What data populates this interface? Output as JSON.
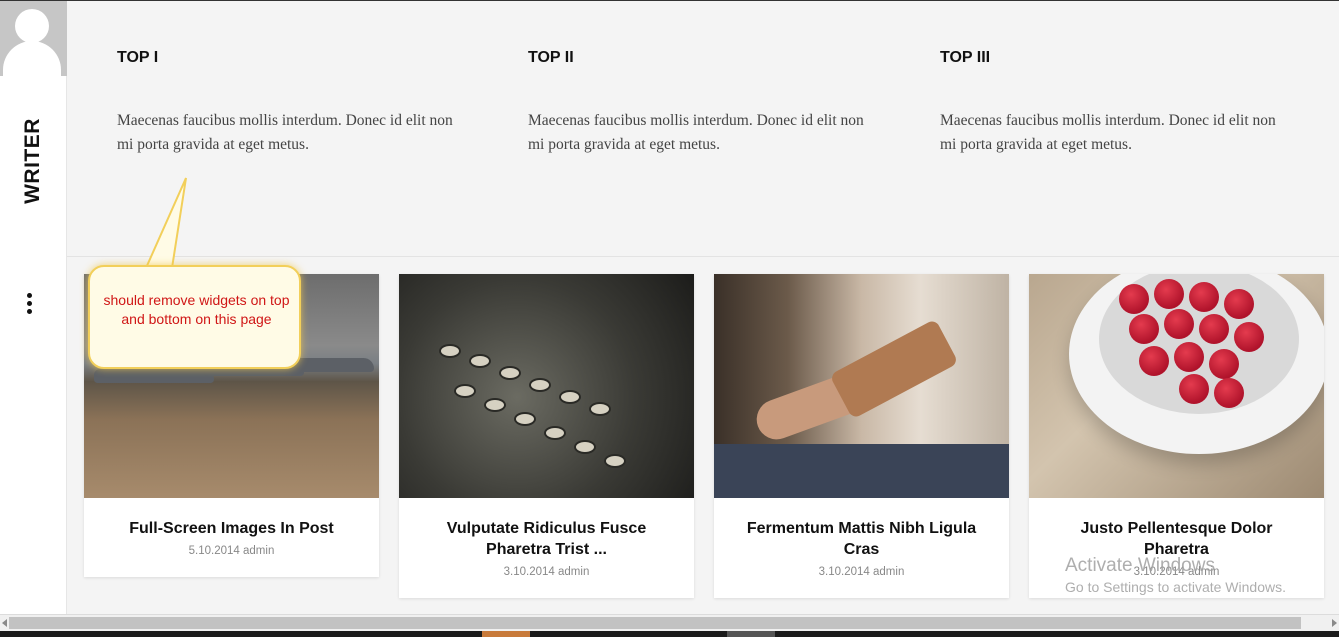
{
  "sidebar": {
    "brand": "WRITER",
    "avatar_icon": "user-avatar-icon",
    "menu_icon": "more-vertical-icon"
  },
  "widgets": [
    {
      "title": "TOP I",
      "text": "Maecenas faucibus mollis interdum. Donec id elit non mi porta gravida at eget metus."
    },
    {
      "title": "TOP II",
      "text": "Maecenas faucibus mollis interdum. Donec id elit non mi porta gravida at eget metus."
    },
    {
      "title": "TOP III",
      "text": "Maecenas faucibus mollis interdum. Donec id elit non mi porta gravida at eget metus."
    }
  ],
  "posts": [
    {
      "title": "Full-Screen Images In Post",
      "meta": "5.10.2014 admin",
      "image": "fighter-jets-airfield"
    },
    {
      "title": "Vulputate Ridiculus Fusce Pharetra Trist ...",
      "meta": "3.10.2014 admin",
      "image": "vintage-typewriter"
    },
    {
      "title": "Fermentum Mattis Nibh Ligula Cras",
      "meta": "3.10.2014 admin",
      "image": "guitar-player"
    },
    {
      "title": "Justo Pellentesque Dolor Pharetra",
      "meta": "3.10.2014 admin",
      "image": "raspberries-cup"
    }
  ],
  "annotation": {
    "text": "should remove widgets on top and bottom on this page"
  },
  "watermark": {
    "line1": "Activate Windows",
    "line2": "Go to Settings to activate Windows."
  },
  "colors": {
    "background": "#f4f4f4",
    "annotation_text": "#d01616",
    "annotation_border": "#f2cf5a"
  }
}
